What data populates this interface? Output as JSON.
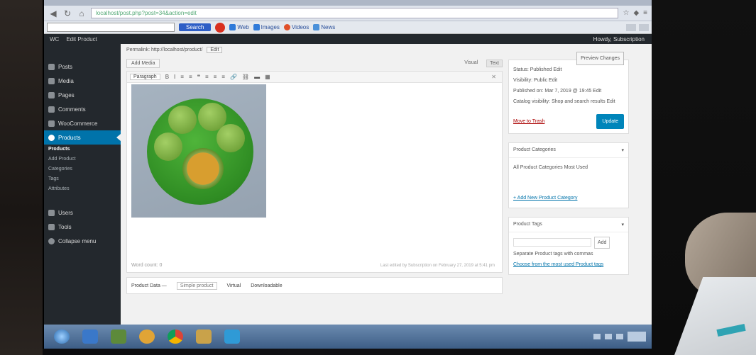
{
  "browser": {
    "url": "localhost/post.php?post=34&action=edit",
    "toolbar": {
      "search_label": "Search",
      "links": [
        {
          "label": "Web",
          "color": "#2f7ad9"
        },
        {
          "label": "Images",
          "color": "#2f7ad9"
        },
        {
          "label": "Videos",
          "color": "#e0502a"
        },
        {
          "label": "News",
          "color": "#4a90d9"
        }
      ]
    }
  },
  "adminbar": {
    "items": [
      "WC",
      "Edit Product"
    ],
    "howdy": "Howdy, Subscription"
  },
  "sidebar": {
    "items": [
      {
        "label": "Posts"
      },
      {
        "label": "Media"
      },
      {
        "label": "Pages"
      },
      {
        "label": "Comments"
      },
      {
        "label": "WooCommerce"
      },
      {
        "label": "Products",
        "active": true
      }
    ],
    "sub": [
      {
        "label": "Products",
        "current": true
      },
      {
        "label": "Add Product"
      },
      {
        "label": "Categories"
      },
      {
        "label": "Tags"
      },
      {
        "label": "Attributes"
      }
    ],
    "lower": [
      {
        "label": "Users"
      },
      {
        "label": "Tools"
      },
      {
        "label": "Collapse menu"
      }
    ]
  },
  "editor": {
    "permalink_label": "Permalink: http://localhost/product/",
    "permalink_edit": "Edit",
    "add_media": "Add Media",
    "tab_visual": "Visual",
    "tab_text": "Text",
    "format_select": "Paragraph",
    "toolbar_glyphs": [
      "B",
      "I",
      "≡",
      "≡",
      "❝",
      "≡",
      "≡",
      "≡",
      "🔗",
      "⛓",
      "▬",
      "▦"
    ],
    "word_count": "Word count: 0",
    "last_edited": "Last edited by Subscription on February 27, 2019 at 5:41 pm",
    "product_data_label": "Product Data —",
    "product_type": "Simple product",
    "virtual": "Virtual",
    "downloadable": "Downloadable"
  },
  "publish": {
    "preview": "Preview Changes",
    "status": "Status: Published Edit",
    "visibility": "Visibility: Public Edit",
    "published_on": "Published on: Mar 7, 2019 @ 19:45 Edit",
    "catalog": "Catalog visibility: Shop and search results Edit",
    "trash": "Move to Trash",
    "update": "Update"
  },
  "categories": {
    "title": "Product Categories",
    "tab_all": "All Product Categories",
    "tab_used": "Most Used",
    "add_new": "+ Add New Product Category"
  },
  "tags": {
    "title": "Product Tags",
    "add": "Add",
    "hint": "Separate Product tags with commas",
    "choose": "Choose from the most used Product tags"
  }
}
